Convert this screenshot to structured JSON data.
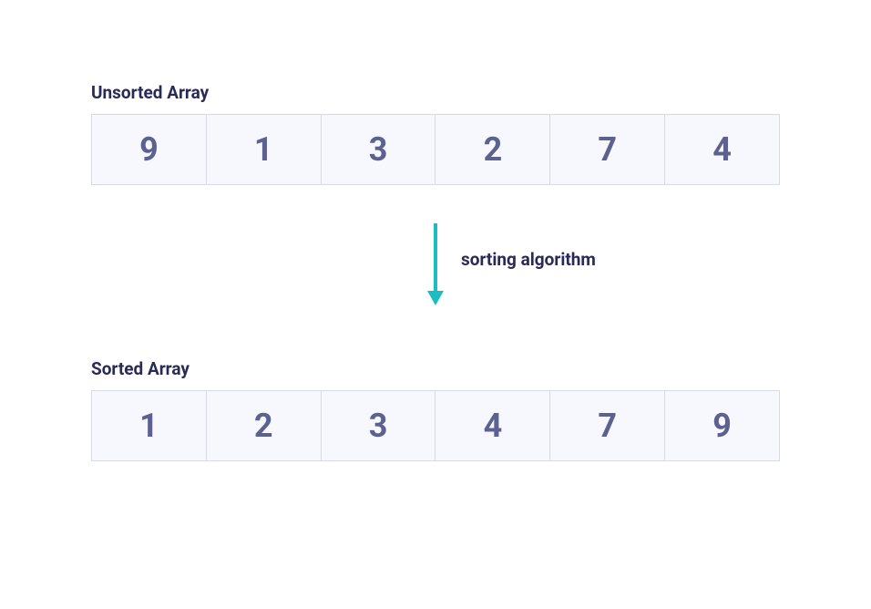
{
  "unsorted": {
    "label": "Unsorted Array",
    "values": [
      "9",
      "1",
      "3",
      "2",
      "7",
      "4"
    ]
  },
  "arrow": {
    "label": "sorting algorithm",
    "color": "#1abdc0"
  },
  "sorted": {
    "label": "Sorted Array",
    "values": [
      "1",
      "2",
      "3",
      "4",
      "7",
      "9"
    ]
  }
}
